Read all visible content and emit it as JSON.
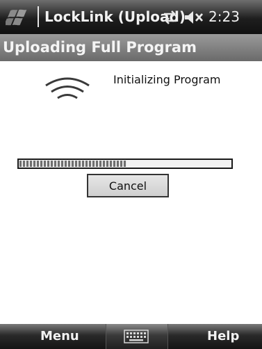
{
  "statusbar": {
    "start_icon": "windows-flag-icon",
    "app_title": "LockLink (Upload)",
    "connectivity_icon": "connectivity-arrows-icon",
    "volume_icon": "speaker-muted-icon",
    "time": "2:23"
  },
  "window": {
    "title": "Uploading Full Program"
  },
  "content": {
    "status_icon": "wireless-signal-icon",
    "status_text": "Initializing Program",
    "progress_fraction": 0.51,
    "cancel_label": "Cancel"
  },
  "softkeys": {
    "left_label": "Menu",
    "right_label": "Help",
    "input_icon": "keyboard-icon"
  },
  "colors": {
    "statusbar_bg": "#1e1e1e",
    "titleband_bg": "#7a7a7a",
    "content_bg": "#ffffff",
    "progress_fill": "#6f6f6f"
  }
}
